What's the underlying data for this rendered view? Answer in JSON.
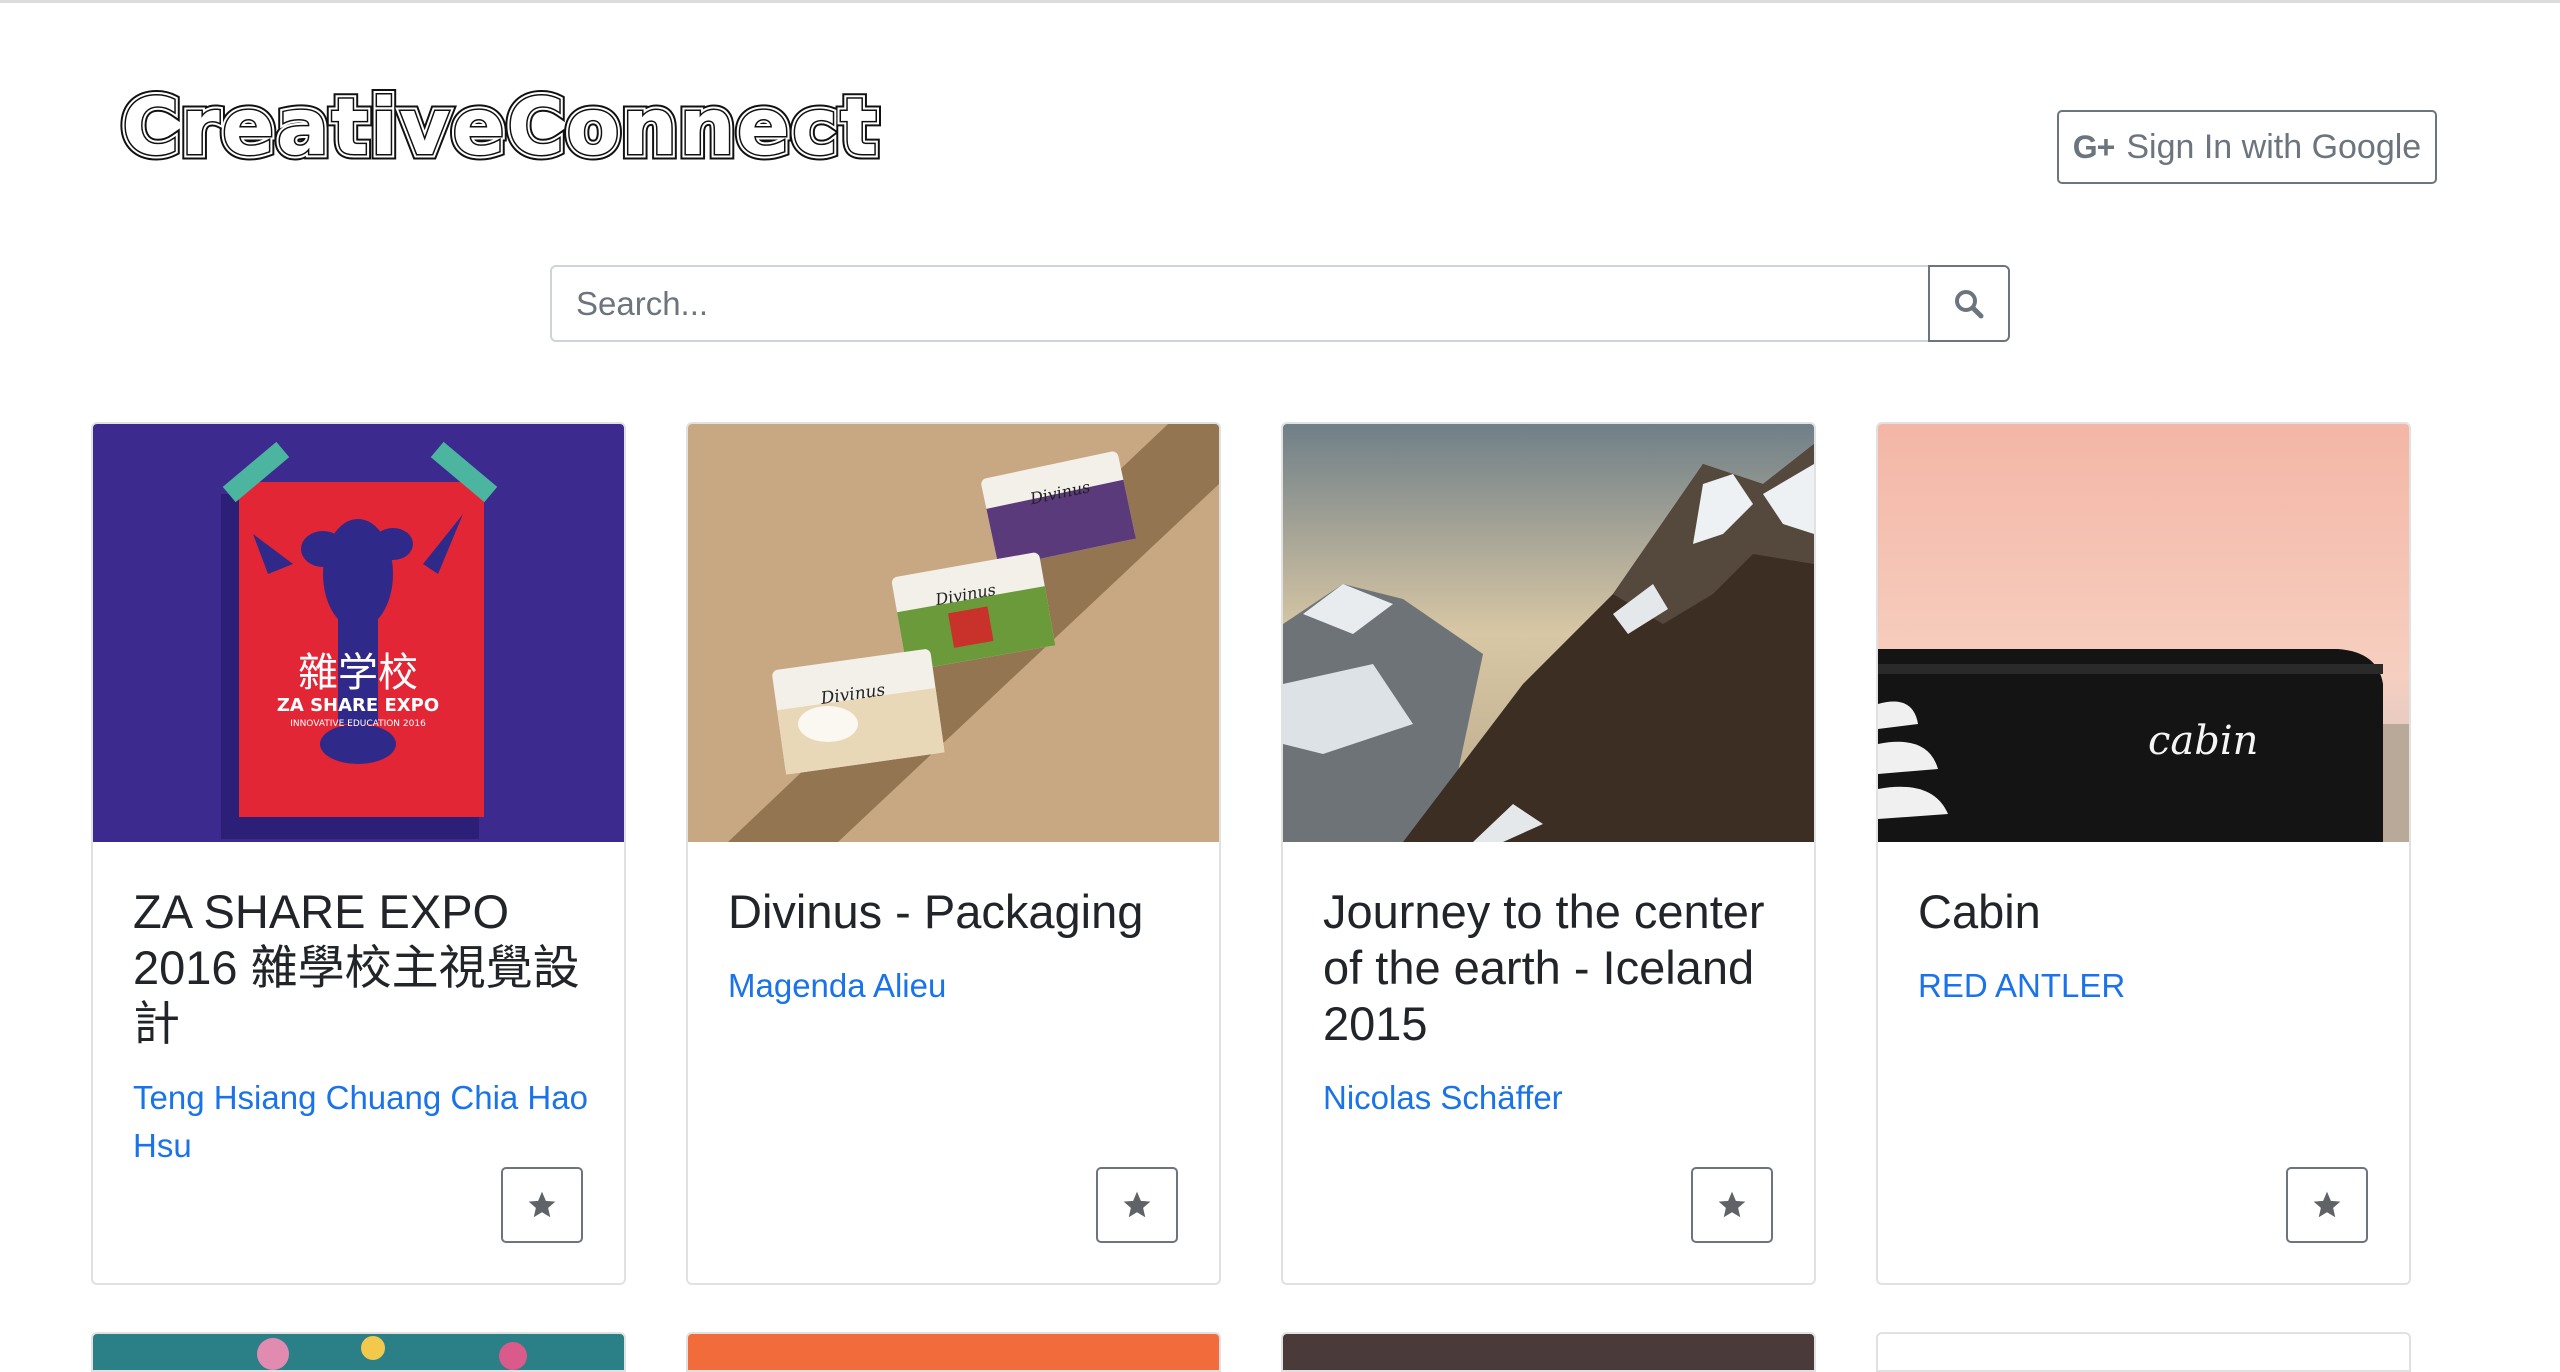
{
  "header": {
    "logo_text": "CreativeConnect",
    "signin_label": "Sign In with Google",
    "signin_icon": "G+"
  },
  "search": {
    "placeholder": "Search...",
    "value": ""
  },
  "cards": [
    {
      "title": "ZA SHARE EXPO 2016 雜學校主視覺設計",
      "author": "Teng Hsiang Chuang Chia Hao Hsu",
      "poster_big": "雜学校",
      "poster_line1": "ZA SHARE EXPO",
      "poster_line2": "INNOVATIVE EDUCATION 2016"
    },
    {
      "title": "Divinus - Packaging",
      "author": "Magenda Alieu",
      "brand": "Divinus"
    },
    {
      "title": "Journey to the center of the earth - Iceland 2015",
      "author": "Nicolas Schäffer"
    },
    {
      "title": "Cabin",
      "author": "RED ANTLER",
      "brand": "cabin"
    }
  ],
  "colors": {
    "link": "#1a73e8",
    "outline_button": "#6c757d",
    "card_border": "#e1e1e1"
  }
}
